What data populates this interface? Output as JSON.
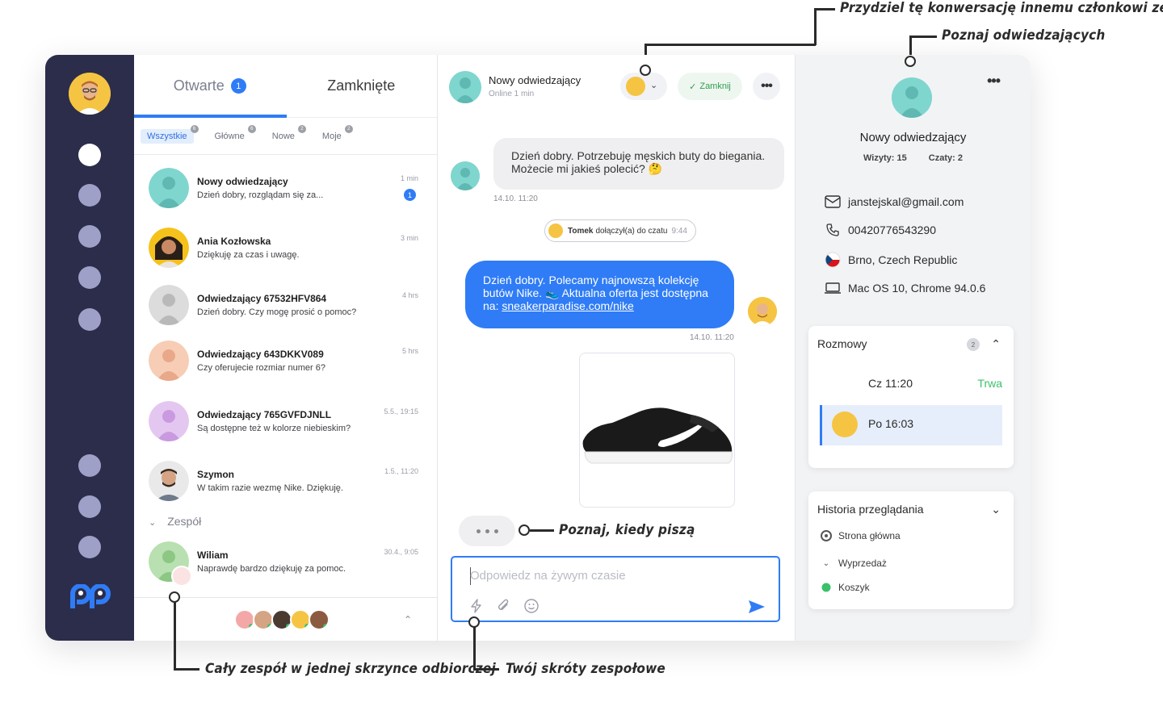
{
  "annotations": {
    "assign": "Przydziel tę konwersację innemu członkowi zespołu",
    "visitors": "Poznaj odwiedzających",
    "typing": "Poznaj, kiedy piszą",
    "team_inbox": "Cały zespół w jednej skrzynce odbiorczej",
    "shortcuts": "Twój skróty zespołowe"
  },
  "list": {
    "tabs": [
      {
        "label": "Otwarte",
        "count": "1"
      },
      {
        "label": "Zamknięte"
      }
    ],
    "filters": [
      {
        "label": "Wszystkie",
        "count": "6"
      },
      {
        "label": "Główne",
        "count": "6"
      },
      {
        "label": "Nowe",
        "count": "2"
      },
      {
        "label": "Moje",
        "count": "2"
      }
    ],
    "conversations": [
      {
        "name": "Nowy odwiedzający",
        "message": "Dzień dobry, rozglądam się za...",
        "time": "1 min",
        "unread": "1"
      },
      {
        "name": "Ania Kozłowska",
        "message": "Dziękuję za czas i uwagę.",
        "time": "3 min"
      },
      {
        "name": "Odwiedzający 67532HFV864",
        "message": "Dzień dobry. Czy mogę prosić o pomoc?",
        "time": "4 hrs"
      },
      {
        "name": "Odwiedzający 643DKKV089",
        "message": "Czy oferujecie rozmiar numer 6?",
        "time": "5 hrs"
      },
      {
        "name": "Odwiedzający 765GVFDJNLL",
        "message": "Są dostępne też w kolorze niebieskim?",
        "time": "5.5., 19:15"
      },
      {
        "name": "Szymon",
        "message": "W takim razie wezmę Nike. Dziękuję.",
        "time": "1.5., 11:20"
      }
    ],
    "team_label": "Zespół",
    "team_conversation": {
      "name": "Wiliam",
      "message": "Naprawdę bardzo dziękuję za pomoc.",
      "time": "30.4., 9:05"
    }
  },
  "chat": {
    "visitor_name": "Nowy odwiedzający",
    "status": "Online 1 min",
    "close_label": "Zamknij",
    "incoming": "Dzień dobry. Potrzebuję męskich buty do biegania. Możecie mi jakieś polecić? 🤔",
    "incoming_time": "14.10. 11:20",
    "joined": {
      "name": "Tomek",
      "text": "dołączył(a) do czatu",
      "time": "9:44"
    },
    "outgoing_text": "Dzień dobry. Polecamy najnowszą kolekcję butów Nike. 👟 Aktualna oferta jest dostępna na: ",
    "outgoing_link": "sneakerparadise.com/nike",
    "outgoing_time": "14.10. 11:20",
    "composer_placeholder": "Odpowiedz na żywym czasie"
  },
  "visitor": {
    "name": "Nowy odwiedzający",
    "visits": "Wizyty: 15",
    "chats": "Czaty: 2",
    "email": "janstejskal@gmail.com",
    "phone": "00420776543290",
    "location": "Brno, Czech Republic",
    "device": "Mac OS 10, Chrome 94.0.6",
    "sessions_title": "Rozmowy",
    "sessions_count": "2",
    "sessions": [
      {
        "time": "Cz 11:20",
        "status": "Trwa"
      },
      {
        "time": "Po 16:03"
      }
    ],
    "history_title": "Historia przeglądania",
    "history": [
      "Strona główna",
      "Wyprzedaż",
      "Koszyk"
    ]
  },
  "colors": {
    "accent": "#2f7cf6",
    "nav": "#2c2d4b",
    "online": "#3ac16c",
    "close": "#2f9e4f"
  }
}
